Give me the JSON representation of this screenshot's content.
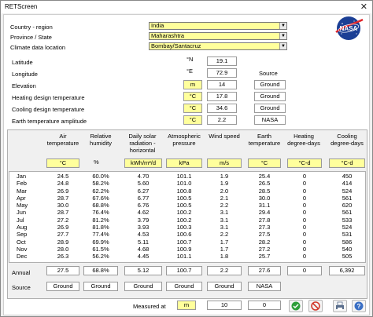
{
  "window": {
    "title": "RETScreen",
    "close_glyph": "✕"
  },
  "location": {
    "country_label": "Country - region",
    "country_value": "India",
    "province_label": "Province / State",
    "province_value": "Maharashtra",
    "climate_label": "Climate data location",
    "climate_value": "Bombay/Santacruz"
  },
  "logo": {
    "text": "NASA"
  },
  "params": {
    "source_header": "Source",
    "rows": [
      {
        "label": "Latitude",
        "unit": "°N",
        "value": "19.1",
        "source": ""
      },
      {
        "label": "Longitude",
        "unit": "°E",
        "value": "72.9",
        "source": ""
      },
      {
        "label": "Elevation",
        "unit": "m",
        "value": "14",
        "source": "Ground"
      },
      {
        "label": "Heating design temperature",
        "unit": "°C",
        "value": "17.8",
        "source": "Ground"
      },
      {
        "label": "Cooling design temperature",
        "unit": "°C",
        "value": "34.6",
        "source": "Ground"
      },
      {
        "label": "Earth temperature amplitude",
        "unit": "°C",
        "value": "2.2",
        "source": "NASA"
      }
    ]
  },
  "table": {
    "headers": [
      "Air temperature",
      "Relative humidity",
      "Daily solar radiation - horizontal",
      "Atmospheric pressure",
      "Wind speed",
      "Earth temperature",
      "Heating degree-days",
      "Cooling degree-days"
    ],
    "units": [
      "°C",
      "%",
      "kWh/m²/d",
      "kPa",
      "m/s",
      "°C",
      "°C-d",
      "°C-d"
    ],
    "months": [
      "Jan",
      "Feb",
      "Mar",
      "Apr",
      "May",
      "Jun",
      "Jul",
      "Aug",
      "Sep",
      "Oct",
      "Nov",
      "Dec"
    ],
    "columns": [
      [
        "24.5",
        "24.8",
        "26.9",
        "28.7",
        "30.0",
        "28.7",
        "27.2",
        "26.9",
        "27.7",
        "28.9",
        "28.0",
        "26.3"
      ],
      [
        "60.0%",
        "58.2%",
        "62.2%",
        "67.6%",
        "68.8%",
        "76.4%",
        "81.2%",
        "81.8%",
        "77.4%",
        "69.9%",
        "61.5%",
        "56.2%"
      ],
      [
        "4.70",
        "5.60",
        "6.27",
        "6.77",
        "6.76",
        "4.62",
        "3.79",
        "3.93",
        "4.53",
        "5.11",
        "4.68",
        "4.45"
      ],
      [
        "101.1",
        "101.0",
        "100.8",
        "100.5",
        "100.5",
        "100.2",
        "100.2",
        "100.3",
        "100.6",
        "100.7",
        "100.9",
        "101.1"
      ],
      [
        "1.9",
        "1.9",
        "2.0",
        "2.1",
        "2.2",
        "3.1",
        "3.1",
        "3.1",
        "2.2",
        "1.7",
        "1.7",
        "1.8"
      ],
      [
        "25.4",
        "26.5",
        "28.5",
        "30.0",
        "31.1",
        "29.4",
        "27.8",
        "27.3",
        "27.5",
        "28.2",
        "27.2",
        "25.7"
      ],
      [
        "0",
        "0",
        "0",
        "0",
        "0",
        "0",
        "0",
        "0",
        "0",
        "0",
        "0",
        "0"
      ],
      [
        "450",
        "414",
        "524",
        "561",
        "620",
        "561",
        "533",
        "524",
        "531",
        "586",
        "540",
        "505"
      ]
    ],
    "annual_label": "Annual",
    "annual": [
      "27.5",
      "68.8%",
      "5.12",
      "100.7",
      "2.2",
      "27.6",
      "0",
      "6,392"
    ],
    "source_label": "Source",
    "sources": [
      "Ground",
      "Ground",
      "Ground",
      "Ground",
      "Ground",
      "NASA",
      "",
      ""
    ]
  },
  "measured": {
    "label": "Measured at",
    "unit": "m",
    "value1": "10",
    "value2": "0"
  },
  "buttons": {
    "ok": "ok-icon",
    "cancel": "cancel-icon",
    "print": "print-icon",
    "help": "help-icon"
  }
}
